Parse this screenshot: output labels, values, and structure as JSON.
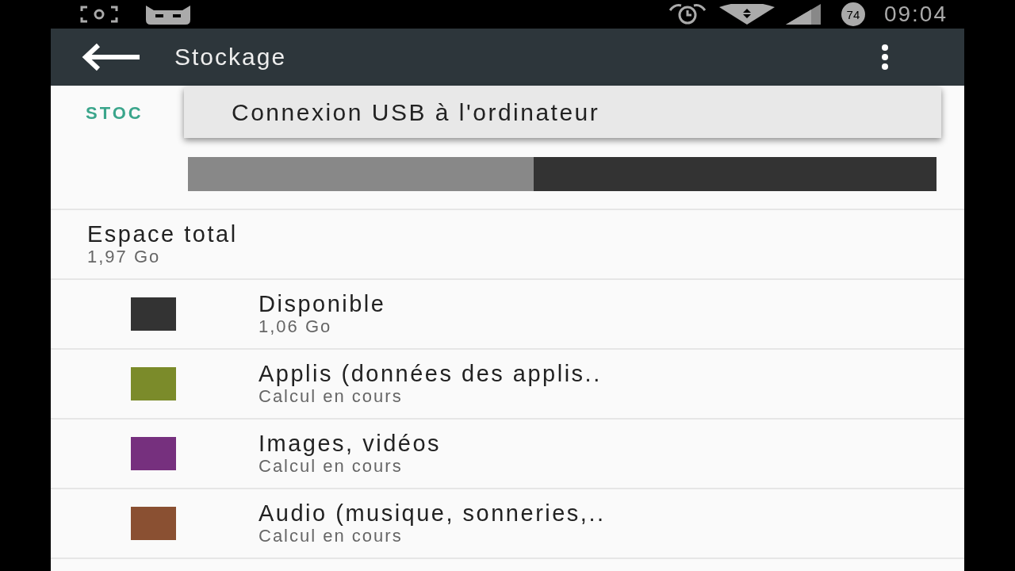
{
  "status_bar": {
    "battery": "74",
    "time": "09:04"
  },
  "app_bar": {
    "title": "Stockage"
  },
  "section_header": "STOC",
  "menu": {
    "items": [
      "Connexion USB à l'ordinateur"
    ]
  },
  "usage_bar": {
    "level": 0.462
  },
  "total": {
    "label": "Espace total",
    "value": "1,97 Go"
  },
  "categories": [
    {
      "name": "Disponible",
      "value": "1,06 Go",
      "color": "#333333"
    },
    {
      "name": "Applis (données des applis..",
      "value": "Calcul en cours",
      "color": "#7b8b2a"
    },
    {
      "name": "Images, vidéos",
      "value": "Calcul en cours",
      "color": "#76307e"
    },
    {
      "name": "Audio (musique, sonneries,..",
      "value": "Calcul en cours",
      "color": "#8a5032"
    }
  ]
}
